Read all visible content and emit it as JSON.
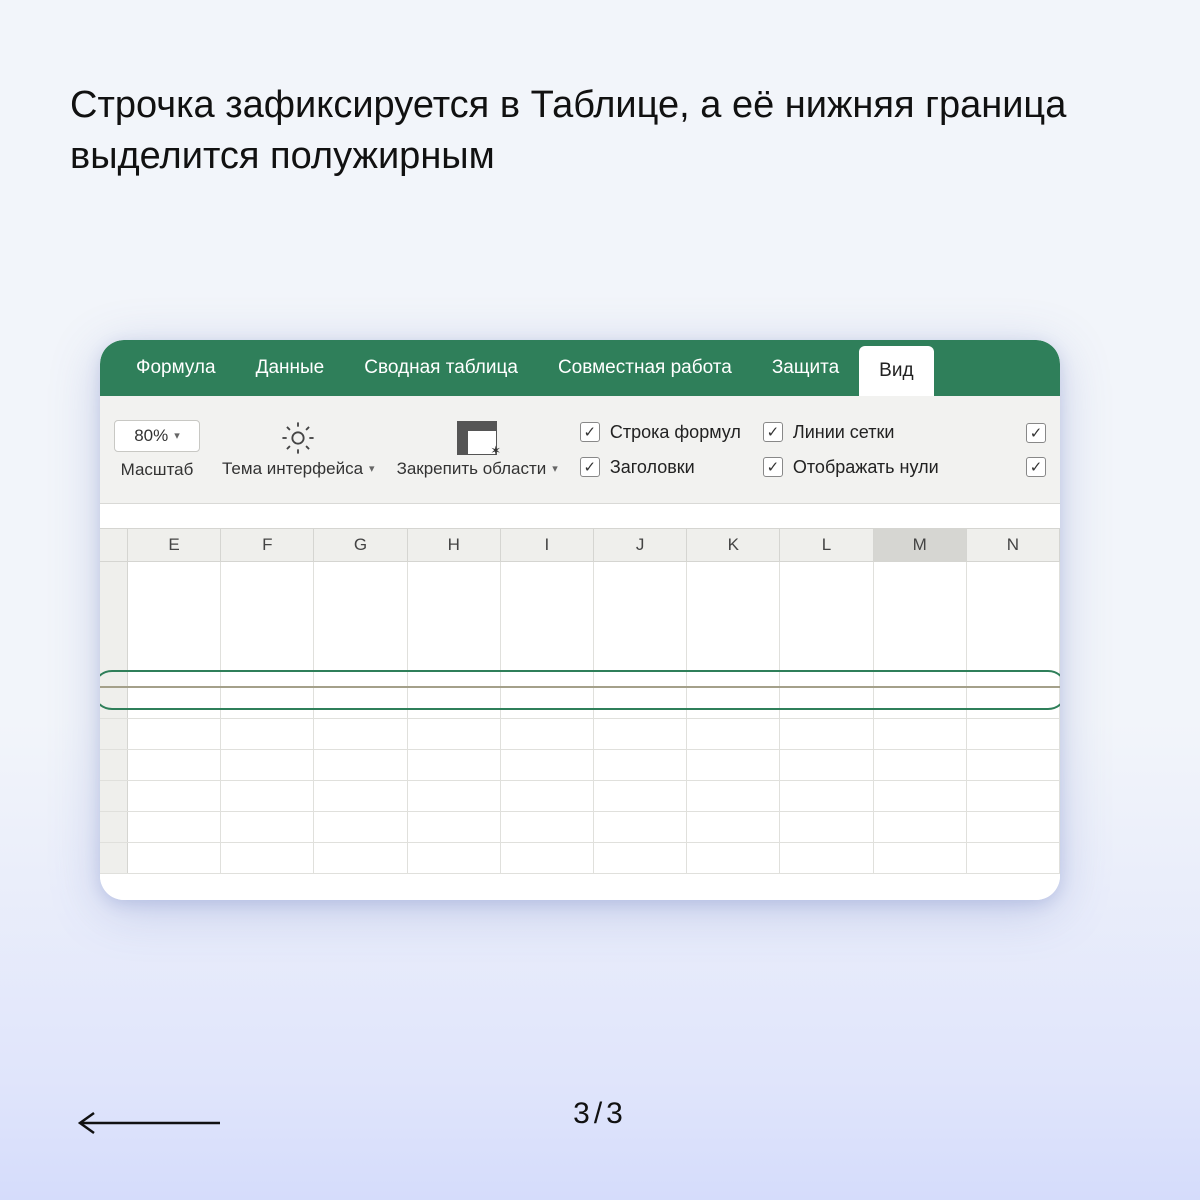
{
  "caption": "Строчка зафиксируется в Таблице, а её нижняя граница выделится полужирным",
  "tabs": {
    "formula": "Формула",
    "data": "Данные",
    "pivot": "Сводная таблица",
    "collab": "Совместная работа",
    "protect": "Защита",
    "view": "Вид"
  },
  "ribbon": {
    "zoom_value": "80%",
    "zoom_label": "Масштаб",
    "theme_label": "Тема интерфейса",
    "freeze_label": "Закрепить области",
    "formula_bar": "Строка формул",
    "headers": "Заголовки",
    "gridlines": "Линии сетки",
    "show_zeros": "Отображать нули"
  },
  "columns": [
    "E",
    "F",
    "G",
    "H",
    "I",
    "J",
    "K",
    "L",
    "M",
    "N"
  ],
  "selected_column": "M",
  "pager": "3/3"
}
